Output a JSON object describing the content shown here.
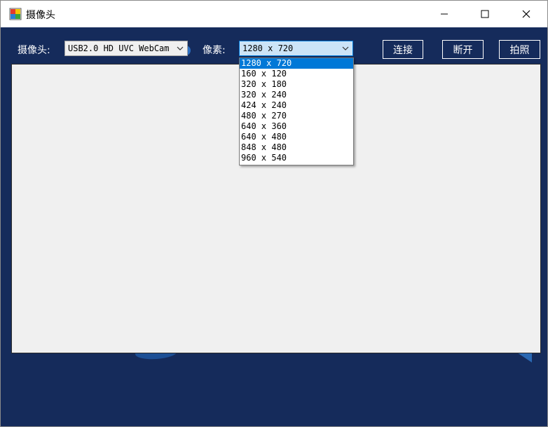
{
  "window": {
    "title": "摄像头"
  },
  "toolbar": {
    "camera_label": "摄像头:",
    "camera_value": "USB2.0 HD UVC WebCam",
    "resolution_label": "像素:",
    "resolution_value": "1280 x 720",
    "connect_label": "连接",
    "disconnect_label": "断开",
    "photo_label": "拍照"
  },
  "resolution_options": [
    "1280 x 720",
    "160 x 120",
    "320 x 180",
    "320 x 240",
    "424 x 240",
    "480 x 270",
    "640 x 360",
    "640 x 480",
    "848 x 480",
    "960 x 540"
  ],
  "selected_option_index": 0,
  "icons": {
    "app": "app-window-icon",
    "minimize": "minimize-icon",
    "maximize": "maximize-icon",
    "close": "close-icon",
    "dropdown": "chevron-down-icon"
  },
  "colors": {
    "client_background": "#152b5b",
    "preview_background": "#f0f0f0",
    "selection": "#0078d7",
    "combo_focus": "#cce4f7"
  }
}
